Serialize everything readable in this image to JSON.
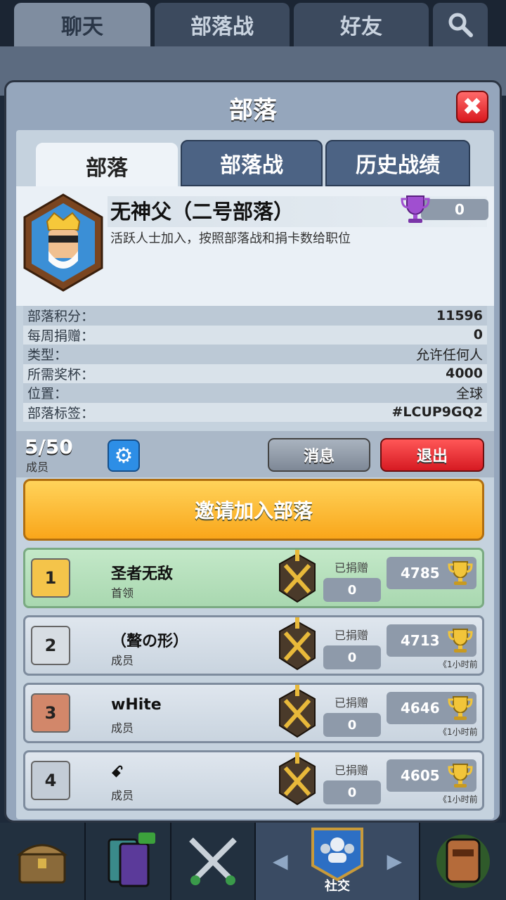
{
  "top_tabs": [
    {
      "label": "聊天"
    },
    {
      "label": "部落战"
    },
    {
      "label": "好友"
    }
  ],
  "modal": {
    "title": "部落",
    "close_label": "✖",
    "tabs": [
      {
        "label": "部落"
      },
      {
        "label": "部落战"
      },
      {
        "label": "历史战绩"
      }
    ]
  },
  "clan": {
    "name": "无神父（二号部落）",
    "description": "活跃人士加入，按照部落战和捐卡数给职位",
    "war_trophies": "0",
    "stats": [
      {
        "label": "部落积分：",
        "value": "11596"
      },
      {
        "label": "每周捐赠：",
        "value": "0"
      },
      {
        "label": "类型：",
        "value": "允许任何人"
      },
      {
        "label": "所需奖杯：",
        "value": "4000"
      },
      {
        "label": "位置：",
        "value": "全球"
      },
      {
        "label": "部落标签：",
        "value": "#LCUP9GQ2"
      }
    ]
  },
  "members_bar": {
    "count": "5/50",
    "label": "成员",
    "message_button": "消息",
    "leave_button": "退出"
  },
  "invite_button": "邀请加入部落",
  "members": [
    {
      "rank": "1",
      "name": "圣者无敌",
      "role": "首领",
      "donated_label": "已捐赠",
      "donated": "0",
      "trophies": "4785",
      "last_seen": "",
      "rank_color": "#f4c44a"
    },
    {
      "rank": "2",
      "name": "（聱の形）",
      "role": "成员",
      "donated_label": "已捐赠",
      "donated": "0",
      "trophies": "4713",
      "last_seen": "《1小时前",
      "rank_color": "#d7dde3"
    },
    {
      "rank": "3",
      "name": "wHite",
      "role": "成员",
      "donated_label": "已捐赠",
      "donated": "0",
      "trophies": "4646",
      "last_seen": "《1小时前",
      "rank_color": "#d2876a"
    },
    {
      "rank": "4",
      "name": "ꗃ",
      "role": "成员",
      "donated_label": "已捐赠",
      "donated": "0",
      "trophies": "4605",
      "last_seen": "《1小时前",
      "rank_color": "#c3ccd6"
    }
  ],
  "bottom_nav": {
    "items": [
      {
        "icon": "chest-shop-icon"
      },
      {
        "icon": "cards-icon"
      },
      {
        "icon": "battle-swords-icon"
      },
      {
        "icon": "social-icon",
        "label": "社交"
      },
      {
        "icon": "tournament-icon"
      }
    ]
  }
}
